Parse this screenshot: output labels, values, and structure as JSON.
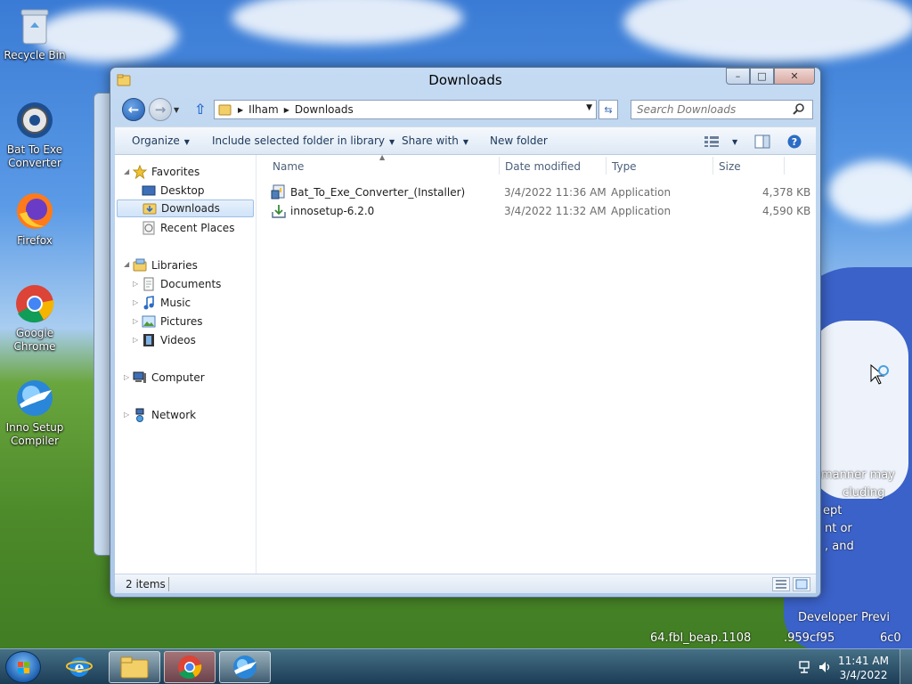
{
  "desktop": {
    "icons": [
      {
        "label": "Recycle Bin"
      },
      {
        "label": "Bat To Exe Converter"
      },
      {
        "label": "Firefox"
      },
      {
        "label": "Google Chrome"
      },
      {
        "label": "Inno Setup Compiler"
      }
    ],
    "watermark": [
      "manner may",
      "cluding",
      "ept",
      "nt or",
      ", and",
      "Developer Previ",
      "64.fbl_beap.1108",
      ".959cf95",
      "6c0"
    ]
  },
  "window": {
    "title": "Downloads",
    "caption": {
      "minimize": "–",
      "maximize": "□",
      "close": "✕"
    },
    "breadcrumb": [
      "Ilham",
      "Downloads"
    ],
    "search_placeholder": "Search Downloads",
    "toolbar": {
      "organize": "Organize",
      "include": "Include selected folder in library",
      "share": "Share with",
      "new_folder": "New folder"
    },
    "nav": {
      "favorites": "Favorites",
      "desktop": "Desktop",
      "downloads": "Downloads",
      "recent": "Recent Places",
      "libraries": "Libraries",
      "documents": "Documents",
      "music": "Music",
      "pictures": "Pictures",
      "videos": "Videos",
      "computer": "Computer",
      "network": "Network"
    },
    "columns": {
      "name": "Name",
      "date": "Date modified",
      "type": "Type",
      "size": "Size"
    },
    "files": [
      {
        "name": "Bat_To_Exe_Converter_(Installer)",
        "date": "3/4/2022 11:36 AM",
        "type": "Application",
        "size": "4,378 KB"
      },
      {
        "name": "innosetup-6.2.0",
        "date": "3/4/2022 11:32 AM",
        "type": "Application",
        "size": "4,590 KB"
      }
    ],
    "status": "2 items"
  },
  "taskbar": {
    "time": "11:41 AM",
    "date": "3/4/2022"
  }
}
